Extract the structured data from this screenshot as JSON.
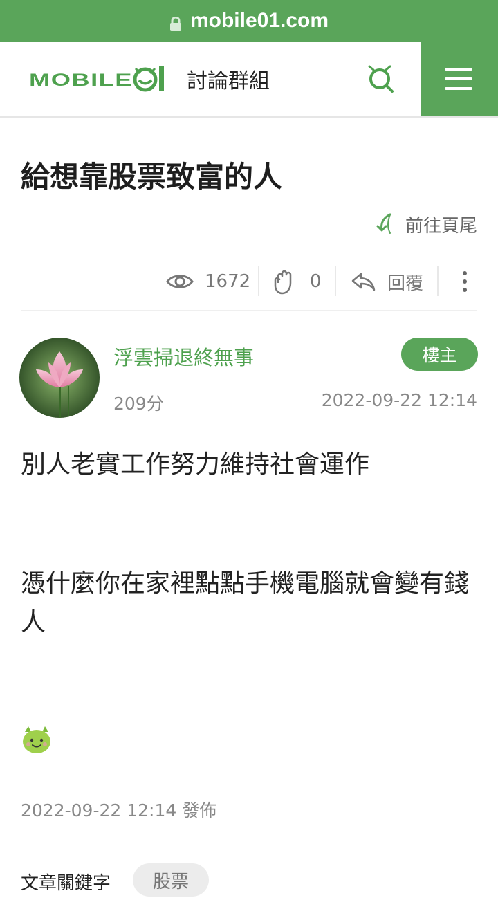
{
  "browser": {
    "url": "mobile01.com"
  },
  "header": {
    "logo_text": "MOBILE01",
    "forum_label": "討論群組",
    "accent_color": "#5aa55a"
  },
  "thread": {
    "title": "給想靠股票致富的人",
    "goto_bottom_label": "前往頁尾",
    "views": "1672",
    "likes": "0",
    "reply_label": "回覆"
  },
  "post": {
    "author": "浮雲掃退終無事",
    "owner_badge": "樓主",
    "score": "209分",
    "time": "2022-09-22 12:14",
    "paragraphs": [
      "別人老實工作努力維持社會運作",
      "憑什麼你在家裡點點手機電腦就會變有錢人"
    ],
    "posted_label": "2022-09-22 12:14 發佈"
  },
  "keywords": {
    "label": "文章關鍵字",
    "tags": [
      "股票"
    ]
  },
  "icons": [
    "lock-icon",
    "search-icon",
    "menu-icon",
    "goto-bottom-icon",
    "eye-icon",
    "clap-icon",
    "reply-icon",
    "more-icon",
    "green-monster-emoji"
  ]
}
